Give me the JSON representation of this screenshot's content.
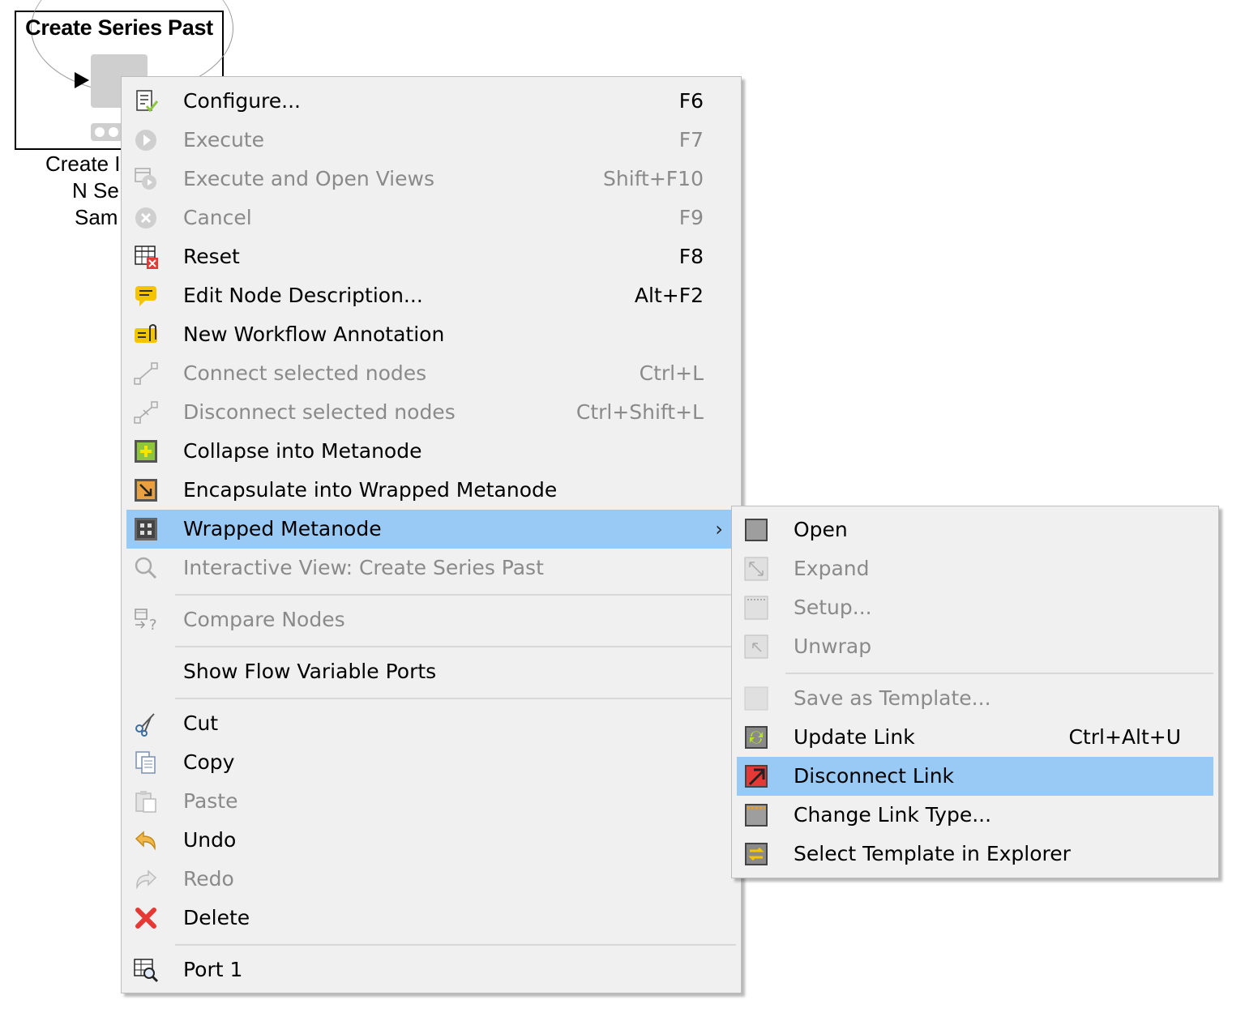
{
  "node": {
    "title": "Create Series Past",
    "label_line1": "Create I",
    "label_line2": "N Se",
    "label_line3": "Sam"
  },
  "context_menu": {
    "items": [
      {
        "label": "Configure...",
        "shortcut": "F6",
        "icon": "configure-icon",
        "enabled": true
      },
      {
        "label": "Execute",
        "shortcut": "F7",
        "icon": "execute-icon",
        "enabled": false
      },
      {
        "label": "Execute and Open Views",
        "shortcut": "Shift+F10",
        "icon": "execute-open-views-icon",
        "enabled": false
      },
      {
        "label": "Cancel",
        "shortcut": "F9",
        "icon": "cancel-icon",
        "enabled": false
      },
      {
        "label": "Reset",
        "shortcut": "F8",
        "icon": "reset-icon",
        "enabled": true
      },
      {
        "label": "Edit Node Description...",
        "shortcut": "Alt+F2",
        "icon": "edit-description-icon",
        "enabled": true
      },
      {
        "label": "New Workflow Annotation",
        "shortcut": "",
        "icon": "annotation-icon",
        "enabled": true
      },
      {
        "label": "Connect selected nodes",
        "shortcut": "Ctrl+L",
        "icon": "connect-icon",
        "enabled": false
      },
      {
        "label": "Disconnect selected nodes",
        "shortcut": "Ctrl+Shift+L",
        "icon": "disconnect-icon",
        "enabled": false
      },
      {
        "label": "Collapse into Metanode",
        "shortcut": "",
        "icon": "collapse-metanode-icon",
        "enabled": true
      },
      {
        "label": "Encapsulate into Wrapped Metanode",
        "shortcut": "",
        "icon": "encapsulate-icon",
        "enabled": true
      },
      {
        "label": "Wrapped Metanode",
        "shortcut": "",
        "icon": "wrapped-metanode-icon",
        "enabled": true,
        "submenu": true
      },
      {
        "label": "Interactive View: Create Series Past",
        "shortcut": "",
        "icon": "magnifier-icon",
        "enabled": false
      },
      {
        "label": "Compare Nodes",
        "shortcut": "",
        "icon": "compare-nodes-icon",
        "enabled": false
      },
      {
        "label": "Show Flow Variable Ports",
        "shortcut": "",
        "icon": "",
        "enabled": true
      },
      {
        "label": "Cut",
        "shortcut": "",
        "icon": "scissors-icon",
        "enabled": true
      },
      {
        "label": "Copy",
        "shortcut": "",
        "icon": "copy-icon",
        "enabled": true
      },
      {
        "label": "Paste",
        "shortcut": "",
        "icon": "paste-icon",
        "enabled": false
      },
      {
        "label": "Undo",
        "shortcut": "",
        "icon": "undo-icon",
        "enabled": true
      },
      {
        "label": "Redo",
        "shortcut": "",
        "icon": "redo-icon",
        "enabled": false
      },
      {
        "label": "Delete",
        "shortcut": "",
        "icon": "delete-icon",
        "enabled": true
      },
      {
        "label": "Port 1",
        "shortcut": "",
        "icon": "port-table-icon",
        "enabled": true
      }
    ]
  },
  "submenu": {
    "items": [
      {
        "label": "Open",
        "shortcut": "",
        "icon": "open-icon",
        "enabled": true
      },
      {
        "label": "Expand",
        "shortcut": "",
        "icon": "expand-icon",
        "enabled": false
      },
      {
        "label": "Setup...",
        "shortcut": "",
        "icon": "setup-icon",
        "enabled": false
      },
      {
        "label": "Unwrap",
        "shortcut": "",
        "icon": "unwrap-icon",
        "enabled": false
      },
      {
        "label": "Save as Template...",
        "shortcut": "",
        "icon": "save-template-icon",
        "enabled": false
      },
      {
        "label": "Update Link",
        "shortcut": "Ctrl+Alt+U",
        "icon": "update-link-icon",
        "enabled": true
      },
      {
        "label": "Disconnect Link",
        "shortcut": "",
        "icon": "disconnect-link-icon",
        "enabled": true
      },
      {
        "label": "Change Link Type...",
        "shortcut": "",
        "icon": "change-link-type-icon",
        "enabled": true
      },
      {
        "label": "Select Template in Explorer",
        "shortcut": "",
        "icon": "select-template-icon",
        "enabled": true
      }
    ]
  },
  "colors": {
    "highlight": "#99c9f5",
    "menu_bg": "#f0f0f0",
    "disabled_text": "#8a8a8a"
  }
}
